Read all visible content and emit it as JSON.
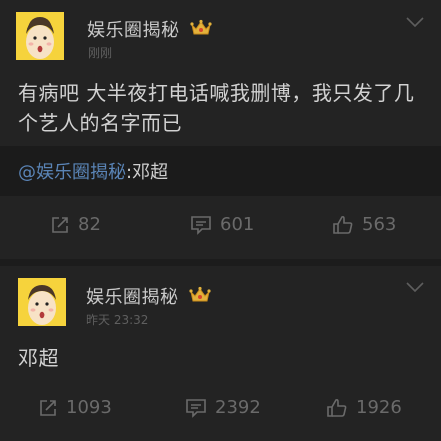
{
  "posts": [
    {
      "username": "娱乐圈揭秘",
      "timestamp": "刚刚",
      "content": "有病吧 大半夜打电话喊我删博，我只发了几个艺人的名字而已",
      "repost": {
        "mention": "@娱乐圈揭秘",
        "text": ":邓超"
      },
      "actions": {
        "reposts": "82",
        "comments": "601",
        "likes": "563"
      }
    },
    {
      "username": "娱乐圈揭秘",
      "timestamp": "昨天 23:32",
      "content": "邓超",
      "actions": {
        "reposts": "1093",
        "comments": "2392",
        "likes": "1926"
      }
    }
  ],
  "icons": {
    "avatar": "cartoon-face-avatar",
    "badge": "crown-icon",
    "menu": "chevron-down-icon",
    "repost": "repost-icon",
    "comment": "comment-icon",
    "like": "thumbs-up-icon"
  },
  "colors": {
    "background": "#1c1c1c",
    "card": "#232323",
    "text": "#d2d2d2",
    "mention": "#5a84b6",
    "muted": "#6a6a6a",
    "avatar_bg": "#f6d33c",
    "crown": "#e3b23c"
  }
}
